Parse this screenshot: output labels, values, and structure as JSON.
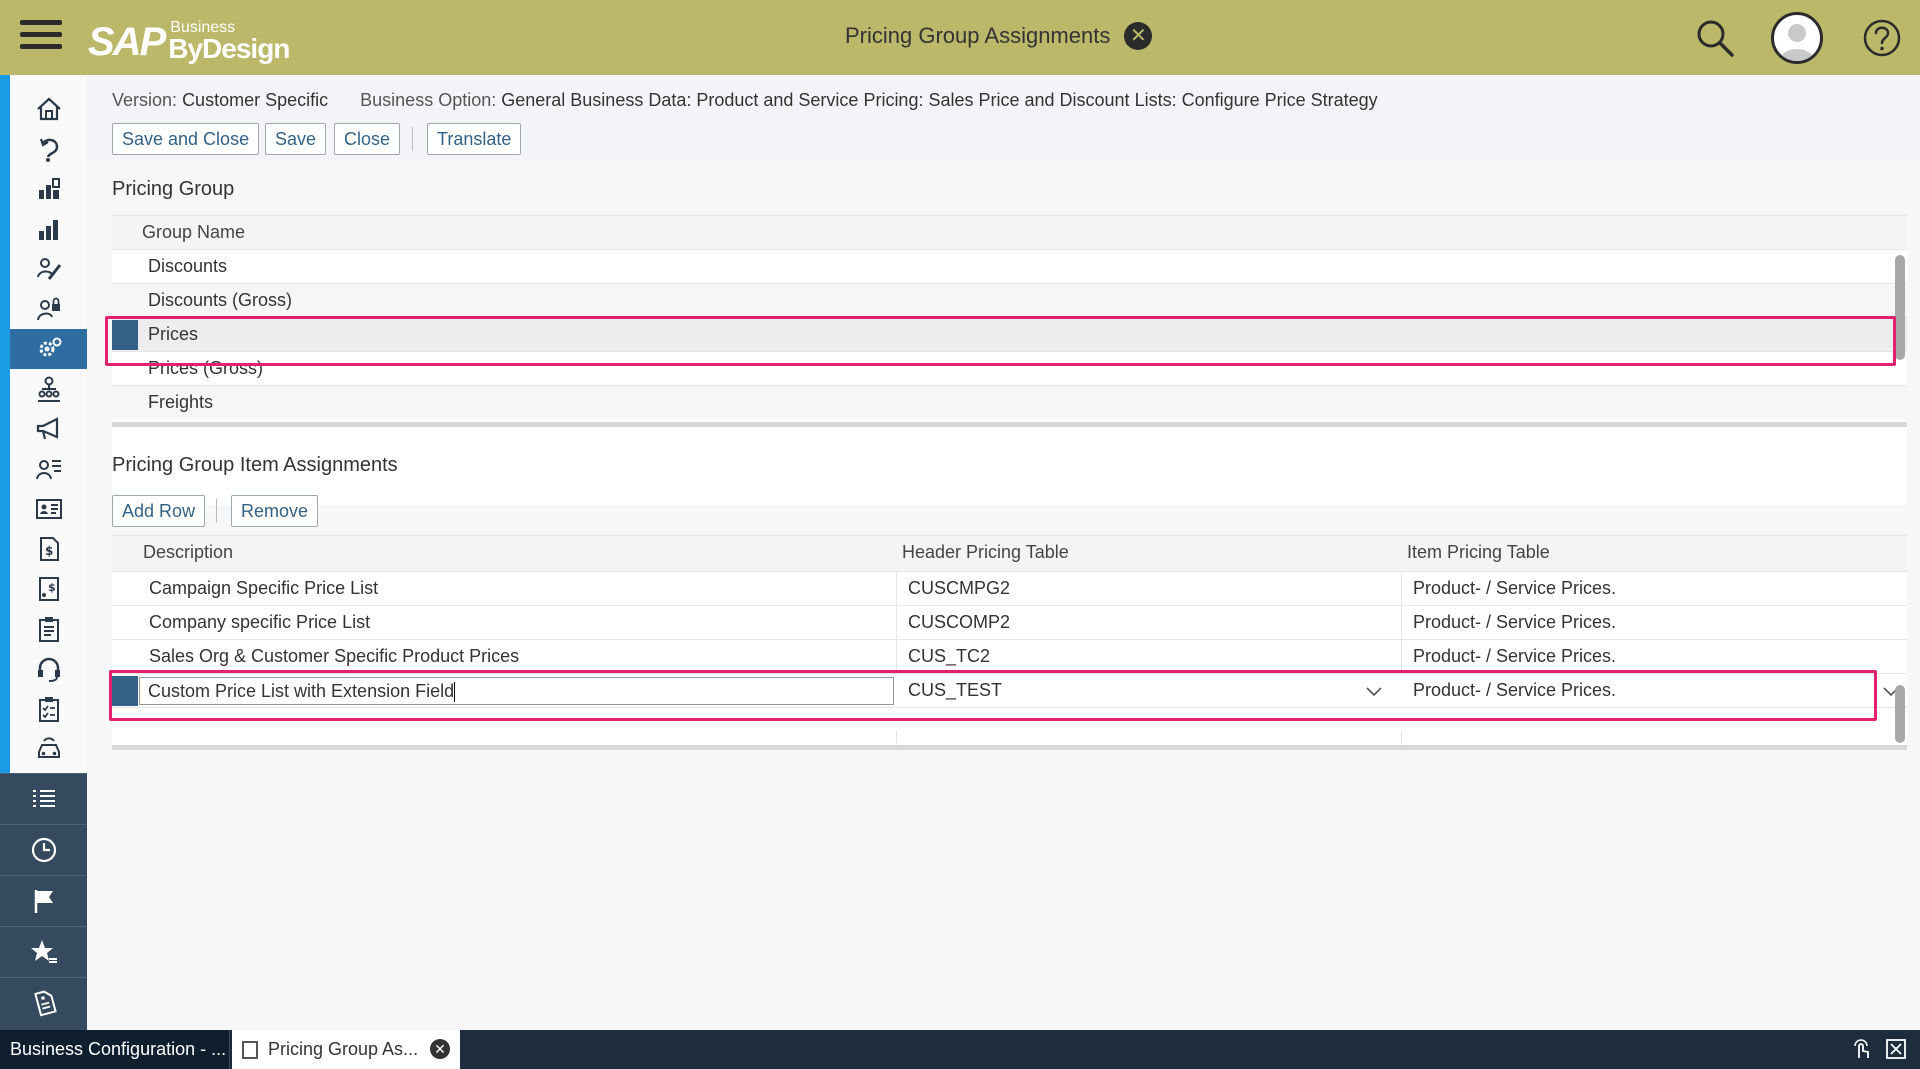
{
  "header": {
    "logo_sap": "SAP",
    "logo_business": "Business",
    "logo_bydesign": "ByDesign",
    "title": "Pricing Group Assignments",
    "close_glyph": "✕"
  },
  "info": {
    "version_label": "Version:",
    "version_value": "Customer Specific",
    "option_label": "Business Option:",
    "option_value": "General Business Data: Product and Service Pricing: Sales Price and Discount Lists: Configure Price Strategy"
  },
  "toolbar": {
    "save_close": "Save and Close",
    "save": "Save",
    "close": "Close",
    "translate": "Translate"
  },
  "pricing_group": {
    "title": "Pricing Group",
    "column": "Group Name",
    "rows": [
      "Discounts",
      "Discounts (Gross)",
      "Prices",
      "Prices (Gross)",
      "Freights"
    ]
  },
  "assignments": {
    "title": "Pricing Group Item Assignments",
    "add_row": "Add Row",
    "remove": "Remove",
    "columns": [
      "Description",
      "Header Pricing Table",
      "Item Pricing Table"
    ],
    "rows": [
      [
        "Campaign Specific Price List",
        "CUSCMPG2",
        "Product- / Service Prices."
      ],
      [
        "Company specific Price List",
        "CUSCOMP2",
        "Product- / Service Prices."
      ],
      [
        "Sales Org & Customer Specific Product Prices",
        "CUS_TC2",
        "Product- / Service Prices."
      ],
      [
        "Custom Price List with Extension Field",
        "CUS_TEST",
        "Product- / Service Prices."
      ]
    ]
  },
  "taskbar": {
    "task1": "Business Configuration - ...",
    "task2": "Pricing Group As...",
    "close_glyph": "✕"
  },
  "colors": {
    "header_bg": "#bcb86a",
    "accent": "#346187",
    "highlight": "#e2226e",
    "sidebar_accent": "#1a9be6"
  }
}
